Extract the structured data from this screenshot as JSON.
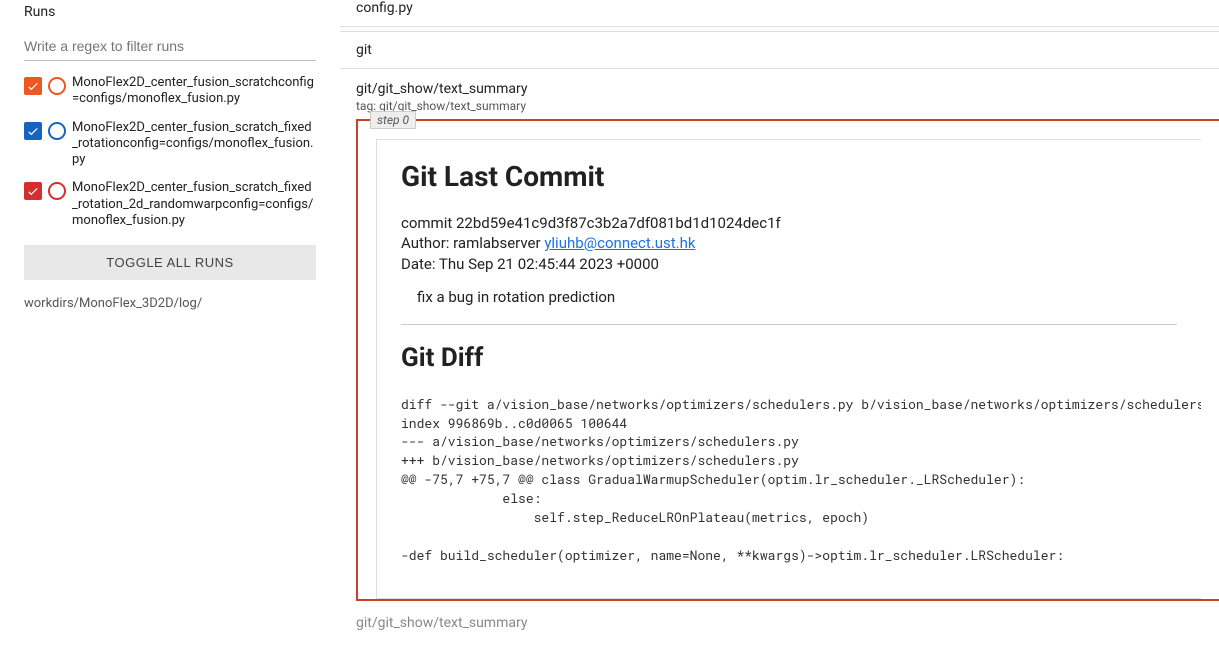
{
  "sidebar": {
    "header": "Runs",
    "filter_placeholder": "Write a regex to filter runs",
    "runs": [
      {
        "color": "#ee5622",
        "label": "MonoFlex2D_center_fusion_scratchconfig=configs/monoflex_fusion.py"
      },
      {
        "color": "#1565c0",
        "label": "MonoFlex2D_center_fusion_scratch_fixed_rotationconfig=configs/monoflex_fusion.py"
      },
      {
        "color": "#d32f2f",
        "label": "MonoFlex2D_center_fusion_scratch_fixed_rotation_2d_randomwarpconfig=configs/monoflex_fusion.py"
      }
    ],
    "toggle_label": "TOGGLE ALL RUNS",
    "workdir": "workdirs/MonoFlex_3D2D/log/"
  },
  "main": {
    "cat1": "config.py",
    "cat2": "git",
    "tag_title": "git/git_show/text_summary",
    "tag_sub": "tag: git/git_show/text_summary",
    "step_label": "step 0",
    "git": {
      "h1": "Git Last Commit",
      "commit": "commit 22bd59e41c9d3f87c3b2a7df081bd1d1024dec1f",
      "author_prefix": "Author: ramlabserver ",
      "author_email": "yliuhb@connect.ust.hk",
      "date": "Date:   Thu Sep 21 02:45:44 2023 +0000",
      "message": "fix a bug in rotation prediction",
      "h2": "Git Diff",
      "diff": "diff --git a/vision_base/networks/optimizers/schedulers.py b/vision_base/networks/optimizers/schedulers.py\nindex 996869b..c0d0065 100644\n--- a/vision_base/networks/optimizers/schedulers.py\n+++ b/vision_base/networks/optimizers/schedulers.py\n@@ -75,7 +75,7 @@ class GradualWarmupScheduler(optim.lr_scheduler._LRScheduler):\n             else:\n                 self.step_ReduceLROnPlateau(metrics, epoch)\n\n-def build_scheduler(optimizer, name=None, **kwargs)->optim.lr_scheduler.LRScheduler:"
    },
    "bottom_tag": "git/git_show/text_summary"
  }
}
